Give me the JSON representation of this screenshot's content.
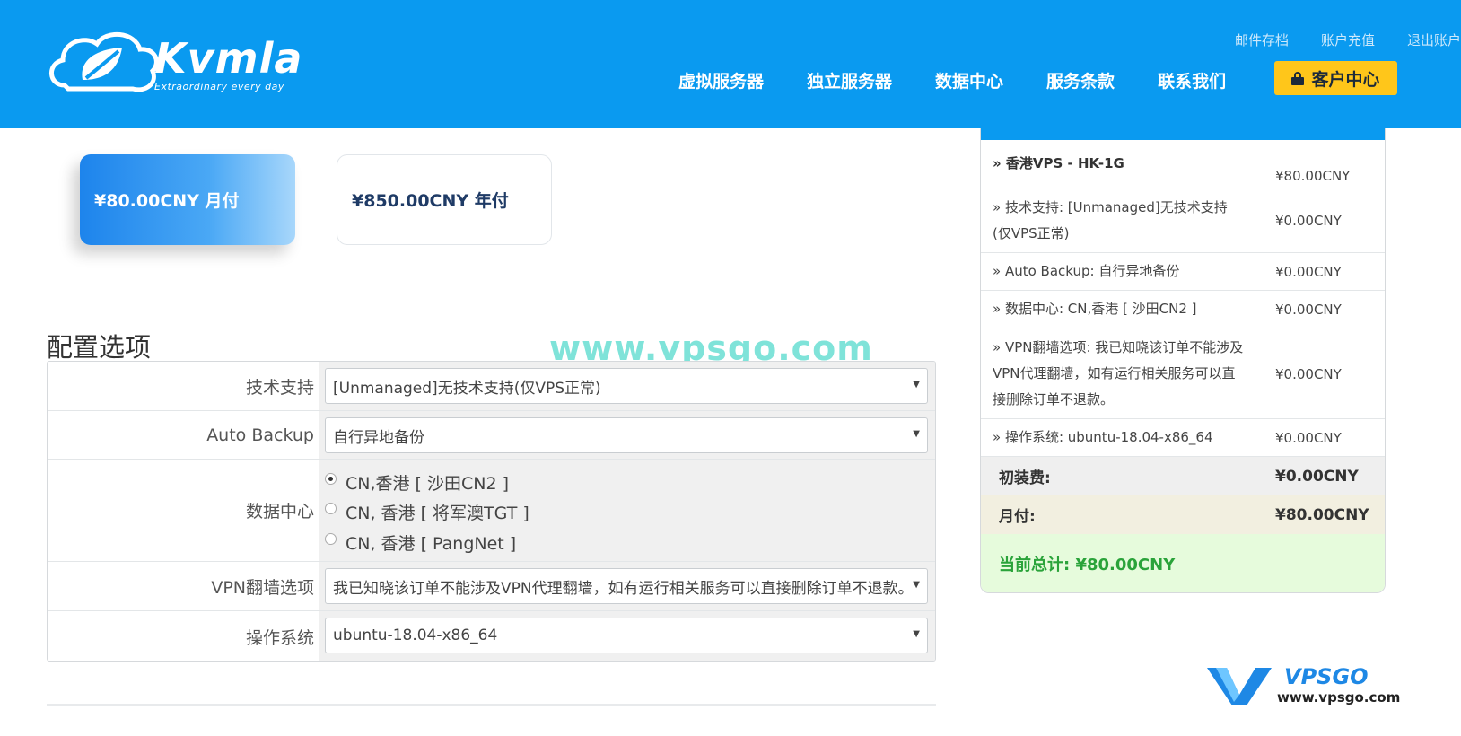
{
  "header": {
    "logo_text": "Kvmla",
    "logo_tagline": "Extraordinary every day",
    "top_links": [
      "邮件存档",
      "账户充值",
      "退出账户"
    ],
    "nav": [
      "虚拟服务器",
      "独立服务器",
      "数据中心",
      "服务条款",
      "联系我们"
    ],
    "client_center": "客户中心",
    "accent_color": "#0a9af0",
    "button_color": "#ffc61a"
  },
  "billing_cycles": [
    {
      "label": "¥80.00CNY 月付",
      "selected": true
    },
    {
      "label": "¥850.00CNY 年付",
      "selected": false
    }
  ],
  "config": {
    "title": "配置选项",
    "watermark": "www.vpsgo.com",
    "rows": {
      "support": {
        "label": "技术支持",
        "value": "[Unmanaged]无技术支持(仅VPS正常)"
      },
      "backup": {
        "label": "Auto Backup",
        "value": "自行异地备份"
      },
      "datacenter": {
        "label": "数据中心",
        "options": [
          "CN,香港 [ 沙田CN2 ]",
          "CN, 香港 [ 将军澳TGT ]",
          "CN, 香港 [ PangNet ]"
        ],
        "selected_index": 0
      },
      "vpn": {
        "label": "VPN翻墙选项",
        "value": "我已知晓该订单不能涉及VPN代理翻墙，如有运行相关服务可以直接删除订单不退款。"
      },
      "os": {
        "label": "操作系统",
        "value": "ubuntu-18.04-x86_64"
      }
    }
  },
  "summary": {
    "items": [
      {
        "desc": "» 香港VPS - HK-1G",
        "price": "¥80.00CNY"
      },
      {
        "desc": "» 技术支持: [Unmanaged]无技术支持(仅VPS正常)",
        "price": "¥0.00CNY"
      },
      {
        "desc": "» Auto Backup: 自行异地备份",
        "price": "¥0.00CNY"
      },
      {
        "desc": "» 数据中心: CN,香港 [ 沙田CN2 ]",
        "price": "¥0.00CNY"
      },
      {
        "desc": "» VPN翻墙选项: 我已知晓该订单不能涉及VPN代理翻墙，如有运行相关服务可以直接删除订单不退款。",
        "price": "¥0.00CNY"
      },
      {
        "desc": "» 操作系统: ubuntu-18.04-x86_64",
        "price": "¥0.00CNY"
      }
    ],
    "setup_label": "初装费:",
    "setup_value": "¥0.00CNY",
    "monthly_label": "月付:",
    "monthly_value": "¥80.00CNY",
    "total_label": "当前总计: ¥80.00CNY",
    "total_color": "#2aa33a"
  },
  "corner_logo": {
    "brand": "VPSGO",
    "url": "www.vpsgo.com"
  }
}
